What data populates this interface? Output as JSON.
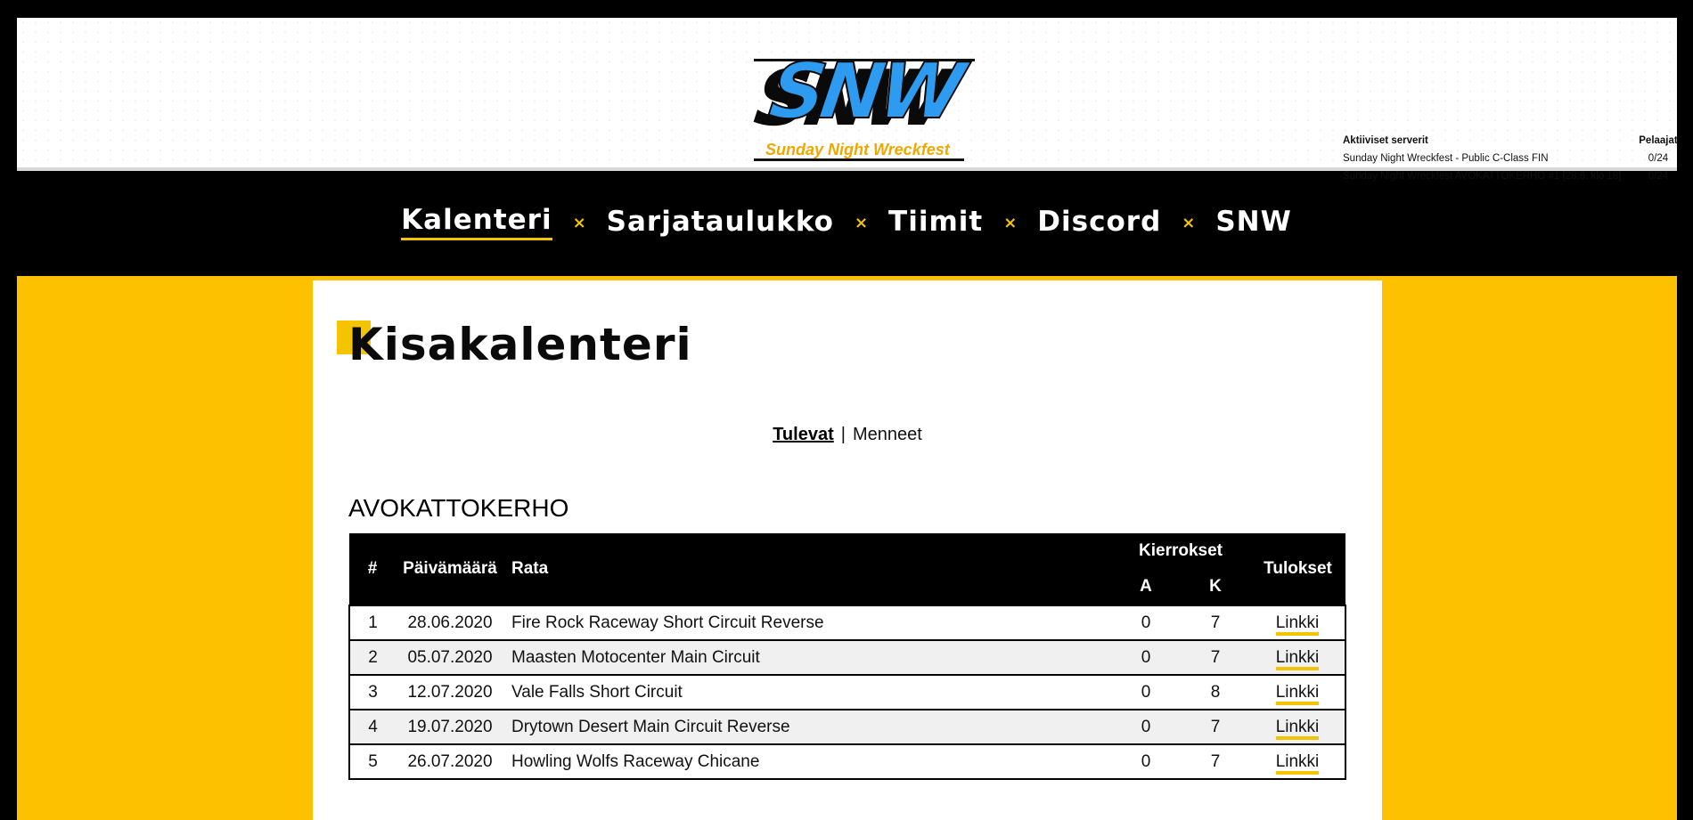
{
  "header": {
    "logo_text": "SNW",
    "logo_subtitle": "Sunday Night Wreckfest"
  },
  "servers": {
    "title": "Aktiiviset serverit",
    "players_label": "Pelaajat",
    "list": [
      {
        "name": "Sunday Night Wreckfest - Public C-Class FIN",
        "players": "0/24"
      },
      {
        "name": "Sunday Night Wreckfest AVOKATTOKERHO #1 [28.6. klo 18]",
        "players": "0/24"
      }
    ]
  },
  "nav": {
    "items": [
      "Kalenteri",
      "Sarjataulukko",
      "Tiimit",
      "Discord",
      "SNW"
    ],
    "separator": "×",
    "active": "Kalenteri",
    "accent_color": "#f5c400"
  },
  "page": {
    "title": "Kisakalenteri",
    "filter_upcoming": "Tulevat",
    "filter_separator": "|",
    "filter_past": "Menneet",
    "section_title": "AVOKATTOKERHO"
  },
  "table": {
    "headers": {
      "num": "#",
      "date": "Päivämäärä",
      "track": "Rata",
      "laps": "Kierrokset",
      "laps_a": "A",
      "laps_k": "K",
      "results": "Tulokset"
    },
    "rows": [
      {
        "num": "1",
        "date": "28.06.2020",
        "track": "Fire Rock Raceway Short Circuit Reverse",
        "a": "0",
        "k": "7",
        "link": "Linkki"
      },
      {
        "num": "2",
        "date": "05.07.2020",
        "track": "Maasten Motocenter Main Circuit",
        "a": "0",
        "k": "7",
        "link": "Linkki"
      },
      {
        "num": "3",
        "date": "12.07.2020",
        "track": "Vale Falls Short Circuit",
        "a": "0",
        "k": "8",
        "link": "Linkki"
      },
      {
        "num": "4",
        "date": "19.07.2020",
        "track": "Drytown Desert Main Circuit Reverse",
        "a": "0",
        "k": "7",
        "link": "Linkki"
      },
      {
        "num": "5",
        "date": "26.07.2020",
        "track": "Howling Wolfs Raceway Chicane",
        "a": "0",
        "k": "7",
        "link": "Linkki"
      }
    ]
  },
  "colors": {
    "background": "#000000",
    "yellow": "#fec100",
    "logo_blue": "#2d9cf0",
    "logo_orange": "#f0a800"
  }
}
